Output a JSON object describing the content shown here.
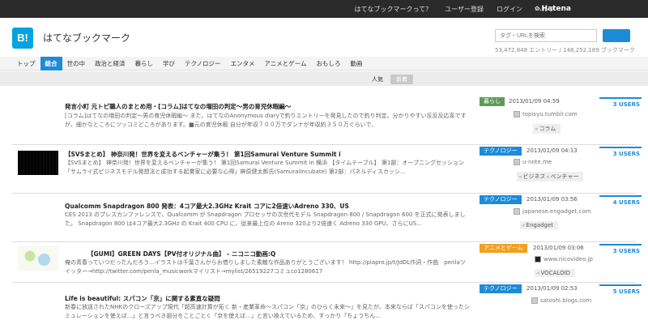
{
  "topbar": {
    "links": [
      "はてなブックマークって？",
      "ユーザー登録",
      "ログイン",
      "ヘルプ"
    ],
    "brand": "Hatena"
  },
  "header": {
    "logo": "B!",
    "title": "はてなブックマーク",
    "search_placeholder": "タグ・URLを検索",
    "stats": "53,472,848 エントリー / 148,252,189 ブックマーク"
  },
  "nav": {
    "items": [
      "トップ",
      "総合",
      "世の中",
      "政治と経済",
      "暮らし",
      "学び",
      "テクノロジー",
      "エンタメ",
      "アニメとゲーム",
      "おもしろ",
      "動画"
    ],
    "active_index": 1
  },
  "subtabs": [
    "人気",
    "新着"
  ],
  "colors": {
    "accent": "#1d8bd9",
    "kurashi": "#5d9b59",
    "technology": "#1d8bd9",
    "anime": "#f0a022"
  },
  "entries": [
    {
      "title": "発言小町 元トピ職人のまとめ用・[コラム]はてなの増田の判定〜男の育児休暇編〜",
      "desc": "[コラム]はてなの増田の判定〜男の育児休暇編〜 また、はてなのAnonymous diaryで釣りエントリーを発見したので釣り判定。分かりやすい反反反応系ですが、細かなところにツッコミどころがあります。■元の育児休暇 自分が年収７００万でダンナが年収約３５０万ぐらいで、",
      "category": "暮らし",
      "date": "2013/01/09 04:59",
      "users": "3 USERS",
      "site": "topisyu.tumblr.com",
      "tags": [
        "コラム"
      ]
    },
    {
      "title": "【SVSまとめ】 神奈川発！世界を変えるベンチャーが集う！ 第1回Samurai Venture Summit i",
      "desc": "【SVSまとめ】 神奈川発！世界を変えるベンチャーが集う！ 第1回Samurai Venture Summit in 横浜 【タイムテーブル】 第1部：オープニングセッション「サムライ式ビジネスモデル発想法と成功する起業家に必要な心得」榊原健太郎氏(SamuraiIncubate) 第2部：パネルディスカッシ...",
      "category": "テクノロジー",
      "date": "2013/01/09 04:13",
      "users": "3 USERS",
      "site": "u-note.me",
      "tags": [
        "ビジネス",
        "ベンチャー"
      ]
    },
    {
      "title": "Qualcomm Snapdragon 800 発表：4コア最大2.3GHz Krait コアに2倍速いAdreno 330、US",
      "desc": "CES 2013 のプレスカンファレンスで、Qualcomm が Snapdragon プロセッサの次世代モデル Snapdragon 800 / Snapdragon 600 を正式に発表しました。 Snapdragon 800 は4コア最大2.3GHz の Krait 400 CPU に、従来最上位の Areno 320より2倍速く Adreno 330 GPU、さらにUS...",
      "category": "テクノロジー",
      "date": "2013/01/09 03:56",
      "users": "4 USERS",
      "site": "japanese.engadget.com",
      "tags": [
        "Engadget"
      ]
    },
    {
      "title": "【GUMI】GREEN DAYS【PV付オリジナル曲】 ‐ ニコニコ動画:Q",
      "desc": "俺の青春っていつだったんだろう...イラストは千葉さんからお借りしました素敵な作品ありがとうございます！ http://piapro.jp/t/JdDL作詞・作曲　penlaツイッター→http://twitter.com/penla_musicworkマイリスト→mylist/26519227コミュco1280617",
      "category": "アニメとゲーム",
      "date": "2013/01/09 03:06",
      "users": "3 USERS",
      "site": "www.nicovideo.jp",
      "tags": [
        "VOCALOID"
      ]
    },
    {
      "title": "Life is beautiful: スパコン「京」に関する素直な疑問",
      "desc": "新春に放送されたNHKのクローズアップ現代「超高速計算が拓く 新・産業革命〜スパコン「京」のひらく未来〜」を見たが、本来ならば「スパコンを使ったシミュレーションを使えば...」と言うべき部分をことごとく「京を使えば...」と言い換えているため、すっかり「ちょうちん...",
      "category": "テクノロジー",
      "date": "2013/01/09 02:53",
      "users": "5 USERS",
      "site": "satoshi.blogs.com",
      "tags": []
    }
  ]
}
